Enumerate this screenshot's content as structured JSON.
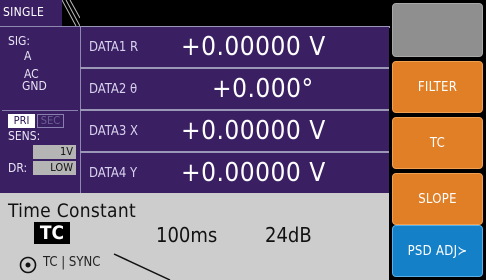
{
  "tab": {
    "label": "SINGLE"
  },
  "info": {
    "sig_label": "SIG:",
    "sig_a": "A",
    "sig_ac": "AC",
    "sig_gnd": "GND",
    "pri": "PRI",
    "sec": "SEC",
    "sens_label": "SENS:",
    "sens_value": "1V",
    "dr_label": "DR:",
    "dr_value": "LOW"
  },
  "rows": [
    {
      "label": "DATA1  R",
      "value": "+0.00000  V"
    },
    {
      "label": "DATA2  θ",
      "value": "+0.000°"
    },
    {
      "label": "DATA3  X",
      "value": "+0.00000  V"
    },
    {
      "label": "DATA4  Y",
      "value": "+0.00000  V"
    }
  ],
  "buttons": {
    "blank": "",
    "filter": "FILTER",
    "tc": "TC",
    "slope": "SLOPE",
    "psd_adj": "PSD ADJ≻"
  },
  "bottom": {
    "title": "Time Constant",
    "tc_badge": "TC",
    "value": "100ms",
    "slope": "24dB",
    "mode": "TC | SYNC"
  },
  "colors": {
    "panel": "#3a1f63",
    "orange": "#e07f25",
    "blue": "#1480c8",
    "gray": "#8f8f8f",
    "bottom": "#cdcdcd"
  }
}
